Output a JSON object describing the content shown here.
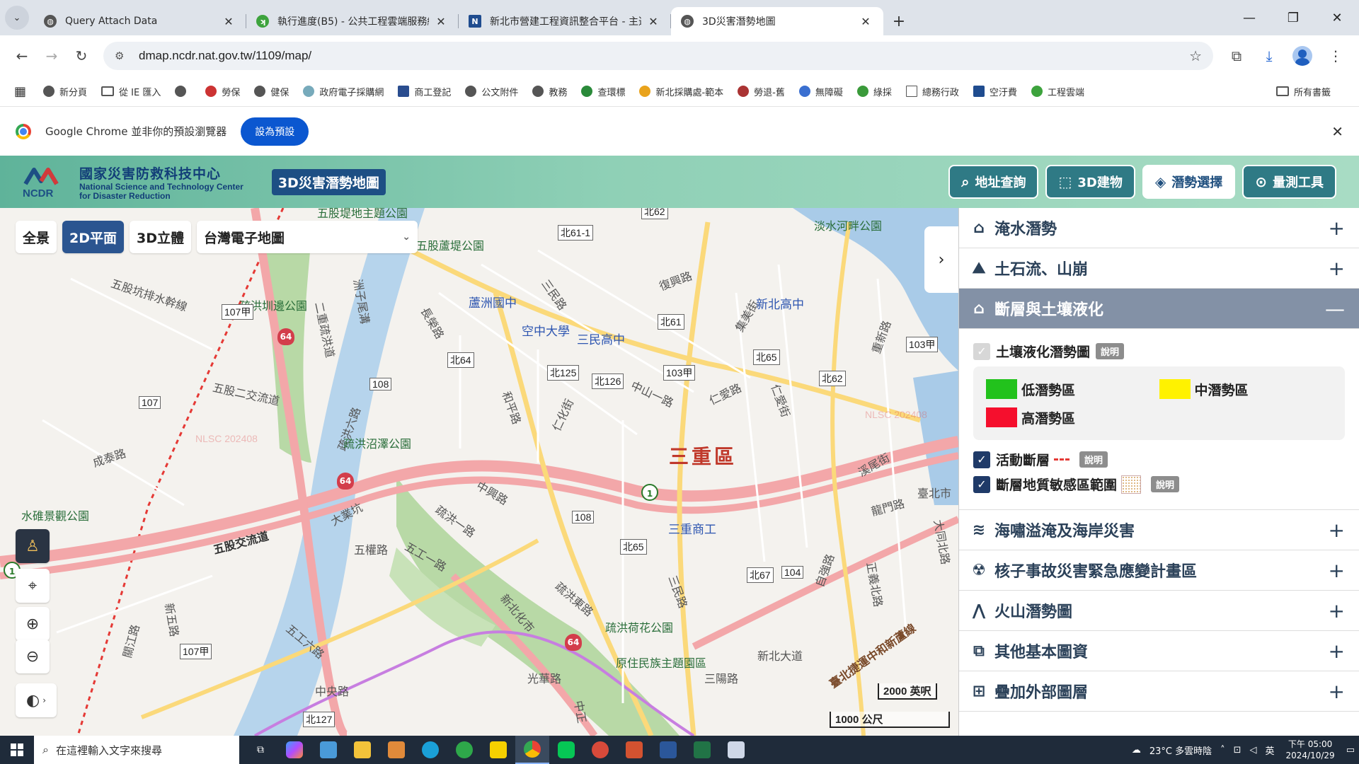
{
  "browser": {
    "tabs": [
      {
        "title": "Query Attach Data",
        "active": false
      },
      {
        "title": "執行進度(B5) - 公共工程雲端服務網",
        "active": false
      },
      {
        "title": "新北市營建工程資訊整合平台 - 主選單",
        "active": false
      },
      {
        "title": "3D災害潛勢地圖",
        "active": true
      }
    ],
    "url": "dmap.ncdr.nat.gov.tw/1109/map/",
    "bookmarks": [
      "新分頁",
      "從 IE 匯入",
      "勞保",
      "健保",
      "政府電子採購網",
      "商工登記",
      "公文附件",
      "教務",
      "查環標",
      "新北採購處-範本",
      "勞退-舊",
      "無障礙",
      "綠採",
      "總務行政",
      "空汙費",
      "工程雲端"
    ],
    "bookmarks_right": "所有書籤",
    "infobar_text": "Google Chrome 並非你的預設瀏覽器",
    "infobar_button": "設為預設"
  },
  "site": {
    "org_cn": "國家災害防救科技中心",
    "org_en_1": "National Science and Technology Center",
    "org_en_2": "for Disaster Reduction",
    "logo_text": "NCDR",
    "title": "3D災害潛勢地圖",
    "header_buttons": [
      {
        "label": "地址查詢",
        "icon": "search-icon",
        "selected": false
      },
      {
        "label": "3D建物",
        "icon": "building-3d-icon",
        "selected": false
      },
      {
        "label": "潛勢選擇",
        "icon": "layers-icon",
        "selected": true
      },
      {
        "label": "量測工具",
        "icon": "measure-icon",
        "selected": false
      }
    ]
  },
  "map": {
    "view_buttons": [
      {
        "label": "全景",
        "selected": false
      },
      {
        "label": "2D平面",
        "selected": true
      },
      {
        "label": "3D立體",
        "selected": false
      }
    ],
    "basemap": "台灣電子地圖",
    "district": "三重區",
    "scale_ft": "2000 英呎",
    "scale_m": "1000 公尺",
    "watermark": "NLSC 202408",
    "labels": {
      "l1": "五股坑排水幹線",
      "l2": "疏洪圳邊公園",
      "l3": "洲子尾溝",
      "l4": "二重疏洪道",
      "l5": "五股二交流道",
      "l6": "疏洪六路",
      "l7": "疏洪沼澤公園",
      "l8": "成泰路",
      "l9": "水碓景觀公園",
      "l10": "五股交流道",
      "l11": "大業坑",
      "l12": "疏洪一路",
      "l13": "五工一路",
      "l14": "五權路",
      "l15": "中興路",
      "l16": "疏洪東路",
      "l17": "新北化市",
      "l18": "疏洪荷花公園",
      "l19": "原住民族主題園區",
      "l20": "光華路",
      "l21": "三陽路",
      "l22": "新北大道",
      "l23": "中央路",
      "l24": "五工六路",
      "l25": "長榮路",
      "l26": "和平路",
      "l27": "仁化街",
      "l28": "三民路",
      "l29": "仁愛路",
      "l30": "復興路",
      "l31": "中山一路",
      "l32": "集美街",
      "l33": "仁愛街",
      "l34": "重新路",
      "l35": "淡水河畔公園",
      "l36": "溪尾街",
      "l37": "龍門路",
      "l38": "臺北市",
      "l39": "自強路",
      "l40": "正義北路",
      "l41": "大同北路",
      "l42": "三民路",
      "l43": "五股堤地主題公園",
      "l44": "五股蘆堤公園",
      "l45": "臺北捷運中和新蘆線",
      "l46": "新五路",
      "l47": "關江路",
      "l48": "中正",
      "s1": "蘆洲國中",
      "s2": "空中大學",
      "s3": "三民高中",
      "s4": "新北高中",
      "s5": "三重商工"
    },
    "shields": {
      "r1": "107甲",
      "r2": "108",
      "r3": "107",
      "r4": "北64",
      "r5": "北125",
      "r6": "北126",
      "r7": "103甲",
      "r8": "北61",
      "r9": "北61-1",
      "r10": "北62",
      "r11": "北65",
      "r12": "北62",
      "r13": "103甲",
      "r14": "108",
      "r15": "北65",
      "r16": "北67",
      "r17": "104",
      "r18": "107甲",
      "r19": "北127",
      "r20": "64",
      "r21": "64",
      "r22": "64",
      "r23": "1",
      "r24": "1"
    }
  },
  "panel": {
    "sections": [
      {
        "label": "淹水潛勢",
        "icon": "flood-icon",
        "open": false
      },
      {
        "label": "土石流、山崩",
        "icon": "landslide-icon",
        "open": false
      },
      {
        "label": "斷層與土壤液化",
        "icon": "fault-icon",
        "open": true
      },
      {
        "label": "海嘯溢淹及海岸災害",
        "icon": "tsunami-icon",
        "open": false
      },
      {
        "label": "核子事故災害緊急應變計畫區",
        "icon": "nuclear-icon",
        "open": false
      },
      {
        "label": "火山潛勢圖",
        "icon": "volcano-icon",
        "open": false
      },
      {
        "label": "其他基本圖資",
        "icon": "map-layers-icon",
        "open": false
      },
      {
        "label": "疊加外部圖層",
        "icon": "add-layer-icon",
        "open": false
      }
    ],
    "liquefaction": {
      "label": "土壤液化潛勢圖",
      "info": "說明",
      "checked": true
    },
    "legend": [
      {
        "label": "低潛勢區",
        "color": "#22c21c"
      },
      {
        "label": "中潛勢區",
        "color": "#fff200"
      },
      {
        "label": "高潛勢區",
        "color": "#f50f2d"
      }
    ],
    "active_fault": {
      "label": "活動斷層",
      "info": "說明",
      "checked": true
    },
    "sensitive_area": {
      "label": "斷層地質敏感區範圍",
      "info": "說明",
      "checked": true
    },
    "plus": "+",
    "minus": "—"
  },
  "taskbar": {
    "search_placeholder": "在這裡輸入文字來搜尋",
    "weather": "23°C 多雲時陰",
    "ime": "英",
    "time": "下午 05:00",
    "date": "2024/10/29"
  }
}
